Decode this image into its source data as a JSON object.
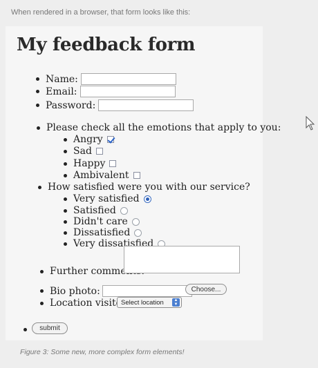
{
  "intro_text": "When rendered in a browser, that form looks like this:",
  "form": {
    "title": "My feedback form",
    "name_label": "Name:",
    "email_label": "Email:",
    "password_label": "Password:",
    "emotions": {
      "question": "Please check all the emotions that apply to you:",
      "options": [
        {
          "label": "Angry",
          "checked": true
        },
        {
          "label": "Sad",
          "checked": false
        },
        {
          "label": "Happy",
          "checked": false
        },
        {
          "label": "Ambivalent",
          "checked": false
        }
      ]
    },
    "satisfaction": {
      "question": "How satisfied were you with our service?",
      "options": [
        {
          "label": "Very satisfied",
          "selected": true
        },
        {
          "label": "Satisfied",
          "selected": false
        },
        {
          "label": "Didn't care",
          "selected": false
        },
        {
          "label": "Dissatisfied",
          "selected": false
        },
        {
          "label": "Very dissatisfied",
          "selected": false
        }
      ]
    },
    "comments_label": "Further comments:",
    "photo_label": "Bio photo:",
    "choose_button": "Choose...",
    "location_label": "Location visited:",
    "location_select": "Select location",
    "submit_button": "submit"
  },
  "caption": "Figure 3: Some new, more complex form elements!",
  "colors": {
    "accent": "#2d5fb8",
    "page_background": "#eeeeee",
    "panel_background": "#f6f6f6"
  },
  "icons": [
    "checkmark-icon",
    "radio-dot-icon",
    "select-arrows-icon",
    "mouse-cursor-icon"
  ]
}
